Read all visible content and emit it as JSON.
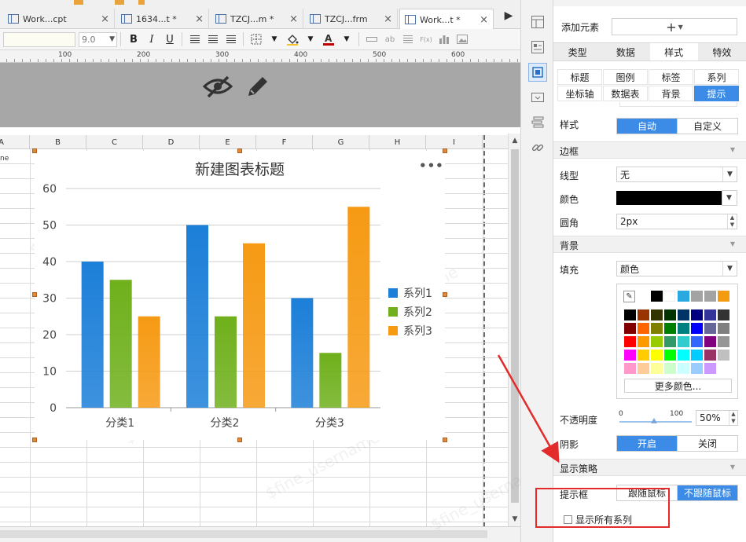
{
  "tabs": [
    {
      "label": "Work...cpt",
      "active": false
    },
    {
      "label": "1634...t *",
      "active": false
    },
    {
      "label": "TZCJ...m *",
      "active": false
    },
    {
      "label": "TZCJ...frm",
      "active": false
    },
    {
      "label": "Work...t *",
      "active": true
    }
  ],
  "toolbar": {
    "font_size": "9.0",
    "bold": "B",
    "italic": "I",
    "underline": "U",
    "fx": "F(x)",
    "ab": "ab"
  },
  "ruler": {
    "labels": [
      "100",
      "200",
      "300",
      "400",
      "500",
      "600"
    ]
  },
  "header_band": {
    "hide_icon": "eye-slash-icon",
    "edit_icon": "pencil-icon"
  },
  "sheet": {
    "columns": [
      "A",
      "B",
      "C",
      "D",
      "E",
      "F",
      "G",
      "H",
      "I"
    ],
    "cell_a1": "ne"
  },
  "watermark": "$fine_username",
  "chart_data": {
    "type": "bar",
    "title": "新建图表标题",
    "categories": [
      "分类1",
      "分类2",
      "分类3"
    ],
    "series": [
      {
        "name": "系列1",
        "values": [
          40,
          50,
          30
        ],
        "color": "#1c7fd8"
      },
      {
        "name": "系列2",
        "values": [
          35,
          25,
          15
        ],
        "color": "#6fb01c"
      },
      {
        "name": "系列3",
        "values": [
          25,
          45,
          55
        ],
        "color": "#f69a14"
      }
    ],
    "ylim": [
      0,
      60
    ],
    "yticks": [
      "0",
      "10",
      "20",
      "30",
      "40",
      "50",
      "60"
    ],
    "grid": true,
    "legend": "right",
    "more_label": "•••"
  },
  "panel": {
    "add_element_label": "添加元素",
    "add_button": "+",
    "main_tabs": [
      {
        "label": "类型",
        "active": false
      },
      {
        "label": "数据",
        "active": false
      },
      {
        "label": "样式",
        "active": true
      },
      {
        "label": "特效",
        "active": false
      }
    ],
    "sub_tabs": [
      {
        "label": "标题",
        "active": false
      },
      {
        "label": "图例",
        "active": false
      },
      {
        "label": "标签",
        "active": false
      },
      {
        "label": "系列",
        "active": false
      },
      {
        "label": "坐标轴",
        "active": false
      },
      {
        "label": "数据表",
        "active": false
      },
      {
        "label": "背景",
        "active": false
      },
      {
        "label": "提示",
        "active": true
      }
    ],
    "style": {
      "label": "样式",
      "auto": "自动",
      "custom": "自定义",
      "selected": "自动"
    },
    "border": {
      "section": "边框",
      "line_label": "线型",
      "line_value": "无",
      "color_label": "颜色",
      "color_value": "#000000",
      "radius_label": "圆角",
      "radius_value": "2px"
    },
    "background": {
      "section": "背景",
      "fill_label": "填充",
      "fill_value": "颜色",
      "more_colors": "更多颜色...",
      "eyedropper_icon": "eyedropper-icon",
      "recent_colors": [
        "#000000",
        "#ffffff",
        "#28a9e0",
        "#a3a3a3",
        "#a3a3a3",
        "#f39c12"
      ],
      "palette": [
        [
          "#000000",
          "#993300",
          "#333300",
          "#003300",
          "#003366",
          "#000080",
          "#333399",
          "#333333"
        ],
        [
          "#800000",
          "#ff6600",
          "#808000",
          "#008000",
          "#008080",
          "#0000ff",
          "#666699",
          "#808080"
        ],
        [
          "#ff0000",
          "#ff9900",
          "#99cc00",
          "#339966",
          "#33cccc",
          "#3366ff",
          "#800080",
          "#969696"
        ],
        [
          "#ff00ff",
          "#ffcc00",
          "#ffff00",
          "#00ff00",
          "#00ffff",
          "#00ccff",
          "#993366",
          "#c0c0c0"
        ],
        [
          "#ff99cc",
          "#ffcc99",
          "#ffff99",
          "#ccffcc",
          "#ccffff",
          "#99ccff",
          "#cc99ff",
          "#ffffff"
        ]
      ]
    },
    "opacity": {
      "label": "不透明度",
      "min": "0",
      "max": "100",
      "value": "50%",
      "fraction": 0.5
    },
    "shadow": {
      "label": "阴影",
      "on": "开启",
      "off": "关闭",
      "selected": "开启"
    },
    "display": {
      "section": "显示策略",
      "tooltip_label": "提示框",
      "follow": "跟随鼠标",
      "not_follow": "不跟随鼠标",
      "selected": "不跟随鼠标",
      "show_all_series": "显示所有系列",
      "show_all_checked": false
    }
  },
  "strip_icons": [
    "layout-icon",
    "form-icon",
    "widget-settings-icon",
    "condition-icon",
    "stack-icon",
    "link-icon"
  ]
}
